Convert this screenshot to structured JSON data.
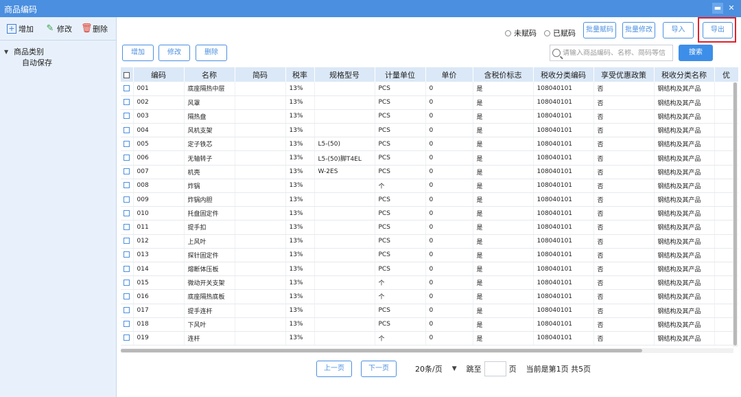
{
  "window": {
    "title": "商品编码",
    "minimize": "▬",
    "close": "✕"
  },
  "sidebar": {
    "toolbar": [
      {
        "label": "增加",
        "icon": "plus-box-icon",
        "color": "#3d7fd6"
      },
      {
        "label": "修改",
        "icon": "edit-icon",
        "color": "#3aa14a"
      },
      {
        "label": "删除",
        "icon": "trash-icon",
        "color": "#e03a2a"
      }
    ],
    "tree": {
      "root": "商品类别",
      "children": [
        "自动保存"
      ]
    }
  },
  "toolbar": {
    "radio_uncoded": "未赋码",
    "radio_coded": "已赋码",
    "batch_code": "批量赋码",
    "batch_edit": "批量修改",
    "import": "导入",
    "export": "导出"
  },
  "actions": {
    "add": "增加",
    "edit": "修改",
    "delete": "删除"
  },
  "search": {
    "placeholder": "请输入商品编码、名称、简码等信息",
    "button": "搜索"
  },
  "table": {
    "columns": [
      "编码",
      "名称",
      "简码",
      "税率",
      "规格型号",
      "计量单位",
      "单价",
      "含税价标志",
      "税收分类编码",
      "享受优惠政策",
      "税收分类名称",
      "优"
    ],
    "rows": [
      [
        "001",
        "底座隔热中层",
        "",
        "13%",
        "",
        "PCS",
        "0",
        "是",
        "108040101",
        "否",
        "钢结构及其产品"
      ],
      [
        "002",
        "风罩",
        "",
        "13%",
        "",
        "PCS",
        "0",
        "是",
        "108040101",
        "否",
        "钢结构及其产品"
      ],
      [
        "003",
        "隔热盘",
        "",
        "13%",
        "",
        "PCS",
        "0",
        "是",
        "108040101",
        "否",
        "钢结构及其产品"
      ],
      [
        "004",
        "风机支架",
        "",
        "13%",
        "",
        "PCS",
        "0",
        "是",
        "108040101",
        "否",
        "钢结构及其产品"
      ],
      [
        "005",
        "定子铁芯",
        "",
        "13%",
        "L5-(50)",
        "PCS",
        "0",
        "是",
        "108040101",
        "否",
        "钢结构及其产品"
      ],
      [
        "006",
        "无轴转子",
        "",
        "13%",
        "L5-(50)脚T4EL",
        "PCS",
        "0",
        "是",
        "108040101",
        "否",
        "钢结构及其产品"
      ],
      [
        "007",
        "机壳",
        "",
        "13%",
        "W-2ES",
        "PCS",
        "0",
        "是",
        "108040101",
        "否",
        "钢结构及其产品"
      ],
      [
        "008",
        "炸锅",
        "",
        "13%",
        "",
        "个",
        "0",
        "是",
        "108040101",
        "否",
        "钢结构及其产品"
      ],
      [
        "009",
        "炸锅内胆",
        "",
        "13%",
        "",
        "PCS",
        "0",
        "是",
        "108040101",
        "否",
        "钢结构及其产品"
      ],
      [
        "010",
        "托盘固定件",
        "",
        "13%",
        "",
        "PCS",
        "0",
        "是",
        "108040101",
        "否",
        "钢结构及其产品"
      ],
      [
        "011",
        "提手扣",
        "",
        "13%",
        "",
        "PCS",
        "0",
        "是",
        "108040101",
        "否",
        "钢结构及其产品"
      ],
      [
        "012",
        "上风叶",
        "",
        "13%",
        "",
        "PCS",
        "0",
        "是",
        "108040101",
        "否",
        "钢结构及其产品"
      ],
      [
        "013",
        "探针固定件",
        "",
        "13%",
        "",
        "PCS",
        "0",
        "是",
        "108040101",
        "否",
        "钢结构及其产品"
      ],
      [
        "014",
        "熔断体压板",
        "",
        "13%",
        "",
        "PCS",
        "0",
        "是",
        "108040101",
        "否",
        "钢结构及其产品"
      ],
      [
        "015",
        "微动开关支架",
        "",
        "13%",
        "",
        "个",
        "0",
        "是",
        "108040101",
        "否",
        "钢结构及其产品"
      ],
      [
        "016",
        "底座隔热底板",
        "",
        "13%",
        "",
        "个",
        "0",
        "是",
        "108040101",
        "否",
        "钢结构及其产品"
      ],
      [
        "017",
        "提手连杆",
        "",
        "13%",
        "",
        "PCS",
        "0",
        "是",
        "108040101",
        "否",
        "钢结构及其产品"
      ],
      [
        "018",
        "下风叶",
        "",
        "13%",
        "",
        "PCS",
        "0",
        "是",
        "108040101",
        "否",
        "钢结构及其产品"
      ],
      [
        "019",
        "连杆",
        "",
        "13%",
        "",
        "个",
        "0",
        "是",
        "108040101",
        "否",
        "钢结构及其产品"
      ]
    ]
  },
  "pager": {
    "prev": "上一页",
    "next": "下一页",
    "page_size": "20条/页",
    "dropdown": "▼",
    "jump_to": "跳至",
    "page_unit": "页",
    "status": "当前是第1页 共5页"
  },
  "colors": {
    "accent": "#4a8fe0",
    "highlight": "#e0202a",
    "header_bg": "#dbe8f7"
  }
}
